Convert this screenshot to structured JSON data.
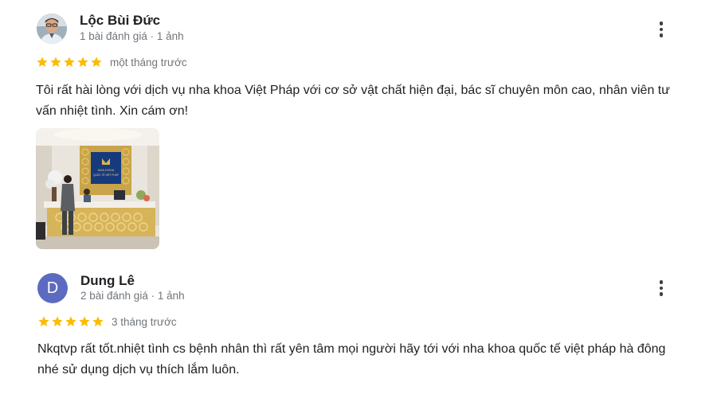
{
  "reviews": [
    {
      "author": "Lộc Bùi Đức",
      "meta": "1 bài đánh giá · 1 ảnh",
      "time": "một tháng trước",
      "stars": 5,
      "text": "Tôi rất hài lòng với dịch vụ nha khoa Việt Pháp với cơ sở vật chất hiện đại, bác sĩ chuyên môn cao, nhân viên tư vấn nhiệt tình. Xin cám ơn!"
    },
    {
      "author": "Dung Lê",
      "avatar_letter": "D",
      "meta": "2 bài đánh giá · 1 ảnh",
      "time": "3 tháng trước",
      "stars": 5,
      "text": "Nkqtvp rất tốt.nhiệt tình cs bệnh nhân thì rất yên tâm mọi người hãy tới với nha khoa quốc tế việt pháp hà đông nhé sử dụng dịch vụ thích lắm luôn."
    }
  ],
  "colors": {
    "star": "#fbbc04",
    "avatar_letter_bg": "#5c6bc0",
    "meta_text": "#70757a"
  },
  "icons": {
    "rating": "star-icon",
    "menu": "more-vert-icon"
  },
  "photo_logo": {
    "line1": "NHA KHOA",
    "line2": "QUỐC TẾ VIỆT PHÁP"
  }
}
